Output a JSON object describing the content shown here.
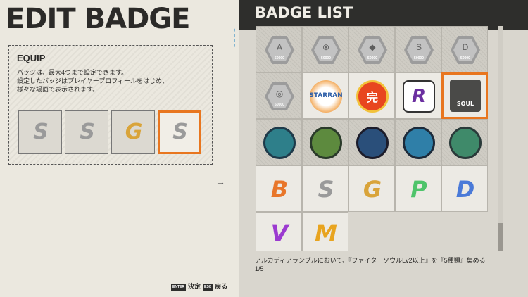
{
  "header": {
    "edit_title": "EDIT BADGE",
    "list_title": "BADGE LIST"
  },
  "equip": {
    "title": "EQUIP",
    "desc_line1": "バッジは、最大4つまで設定できます。",
    "desc_line2": "設定したバッジはプレイヤープロフィールをはじめ、",
    "desc_line3": "様々な場面で表示されます。",
    "slots": [
      {
        "letter": "S",
        "color": "#d8d8d8"
      },
      {
        "letter": "S",
        "color": "#d8d8d8"
      },
      {
        "letter": "G",
        "color": "#e6b64a"
      },
      {
        "letter": "S",
        "color": "#d8d8d8"
      }
    ],
    "selected_slot": 4
  },
  "badges": {
    "row1": [
      {
        "type": "hex",
        "glyph": "A",
        "num": "50000"
      },
      {
        "type": "hex",
        "glyph": "⊗",
        "num": "50000"
      },
      {
        "type": "hex",
        "glyph": "◆",
        "num": "50000"
      },
      {
        "type": "hex",
        "glyph": "S",
        "num": "50000"
      },
      {
        "type": "hex",
        "glyph": "D",
        "num": "50000"
      }
    ],
    "row2": [
      {
        "type": "hex",
        "glyph": "◎",
        "num": "50000"
      },
      {
        "type": "emblem",
        "label": "STARRAN",
        "color": "#2e5fa8"
      },
      {
        "type": "emblem",
        "label": "完",
        "color": "#e8461f"
      },
      {
        "type": "emblem",
        "label": "R",
        "color": "#6b2fa0"
      },
      {
        "type": "soul",
        "label": "SOUL"
      }
    ],
    "row3": [
      {
        "type": "circle",
        "color": "#2e7f8a"
      },
      {
        "type": "circle",
        "color": "#5d8a3e"
      },
      {
        "type": "circle",
        "color": "#2a4f7a"
      },
      {
        "type": "circle",
        "color": "#2f7fa8"
      },
      {
        "type": "circle",
        "color": "#3f8a6a"
      }
    ],
    "row4": [
      {
        "type": "letter",
        "letter": "B",
        "color": "#e8762a"
      },
      {
        "type": "letter",
        "letter": "S",
        "color": "#cfcfcf"
      },
      {
        "type": "letter",
        "letter": "G",
        "color": "#e6b64a"
      },
      {
        "type": "letter",
        "letter": "P",
        "color": "#4ec46a"
      },
      {
        "type": "letter",
        "letter": "D",
        "color": "#4a7ad8"
      }
    ],
    "row5": [
      {
        "type": "letter",
        "letter": "V",
        "color": "#9b3ad0"
      },
      {
        "type": "letter",
        "letter": "M",
        "color": "#e8a41f"
      }
    ]
  },
  "mission": {
    "text": "アルカディアランブルにおいて、『ファイターソウルLv2以上』を『5種類』集める",
    "progress": "1/5"
  },
  "hints": {
    "enter_key": "ENTER",
    "enter_label": "決定",
    "esc_key": "ESC",
    "esc_label": "戻る"
  }
}
